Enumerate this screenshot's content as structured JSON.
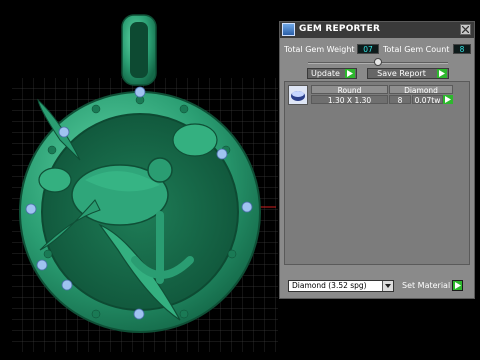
{
  "viewport": {
    "object_icon": "pendant-icon",
    "accent_color": "#2fa67a",
    "gem_color": "#9fc3f0"
  },
  "panel": {
    "title": "GEM REPORTER",
    "app_icon": "gem-reporter-icon",
    "close_icon": "close-icon",
    "total_gem_weight_label": "Total Gem Weight",
    "total_gem_weight_value": "07",
    "total_gem_count_label": "Total Gem Count",
    "total_gem_count_value": "8",
    "update_label": "Update",
    "save_report_label": "Save Report",
    "gem_table": {
      "headers": {
        "shape": "Round",
        "material": "Diamond"
      },
      "row": {
        "size": "1.30 X 1.30",
        "count": "8",
        "weight": "0.07tw"
      }
    },
    "material_select_value": "Diamond    (3.52 spg)",
    "set_material_label": "Set Material",
    "accent_arrow_color": "#2db82d",
    "value_text_color": "#36e6e6"
  }
}
